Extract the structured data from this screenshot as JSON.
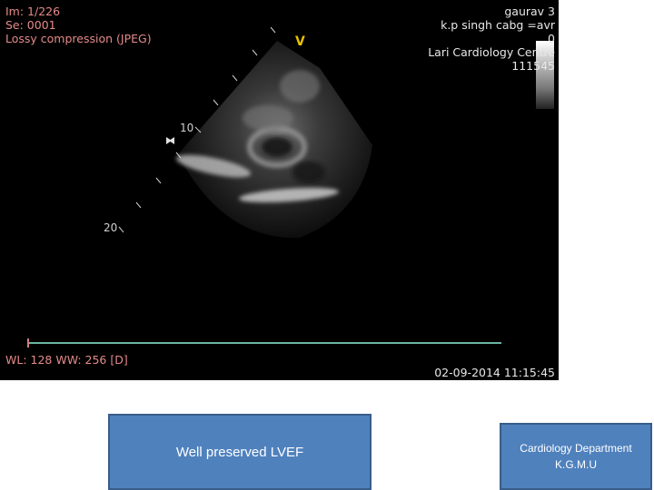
{
  "viewer": {
    "top_left": {
      "image_index": "Im: 1/226",
      "series": "Se: 0001",
      "compression": "Lossy compression (JPEG)"
    },
    "top_right": {
      "patient_name": "gaurav 3",
      "study": "k.p singh cabg =avr",
      "line3": "0",
      "institution": "Lari Cardiology Centre",
      "id": "111545"
    },
    "depth_marks": [
      "10",
      "20"
    ],
    "orientation_marker": "V",
    "window_level": "WL: 128 WW: 256 [D]",
    "timestamp": "02-09-2014 11:15:45"
  },
  "captions": {
    "finding": "Well preserved LVEF",
    "department_line1": "Cardiology Department",
    "department_line2": "K.G.M.U"
  },
  "colors": {
    "overlay_red": "#e58a8a",
    "box_fill": "#4f81bd",
    "timeline": "#69b3a2"
  }
}
